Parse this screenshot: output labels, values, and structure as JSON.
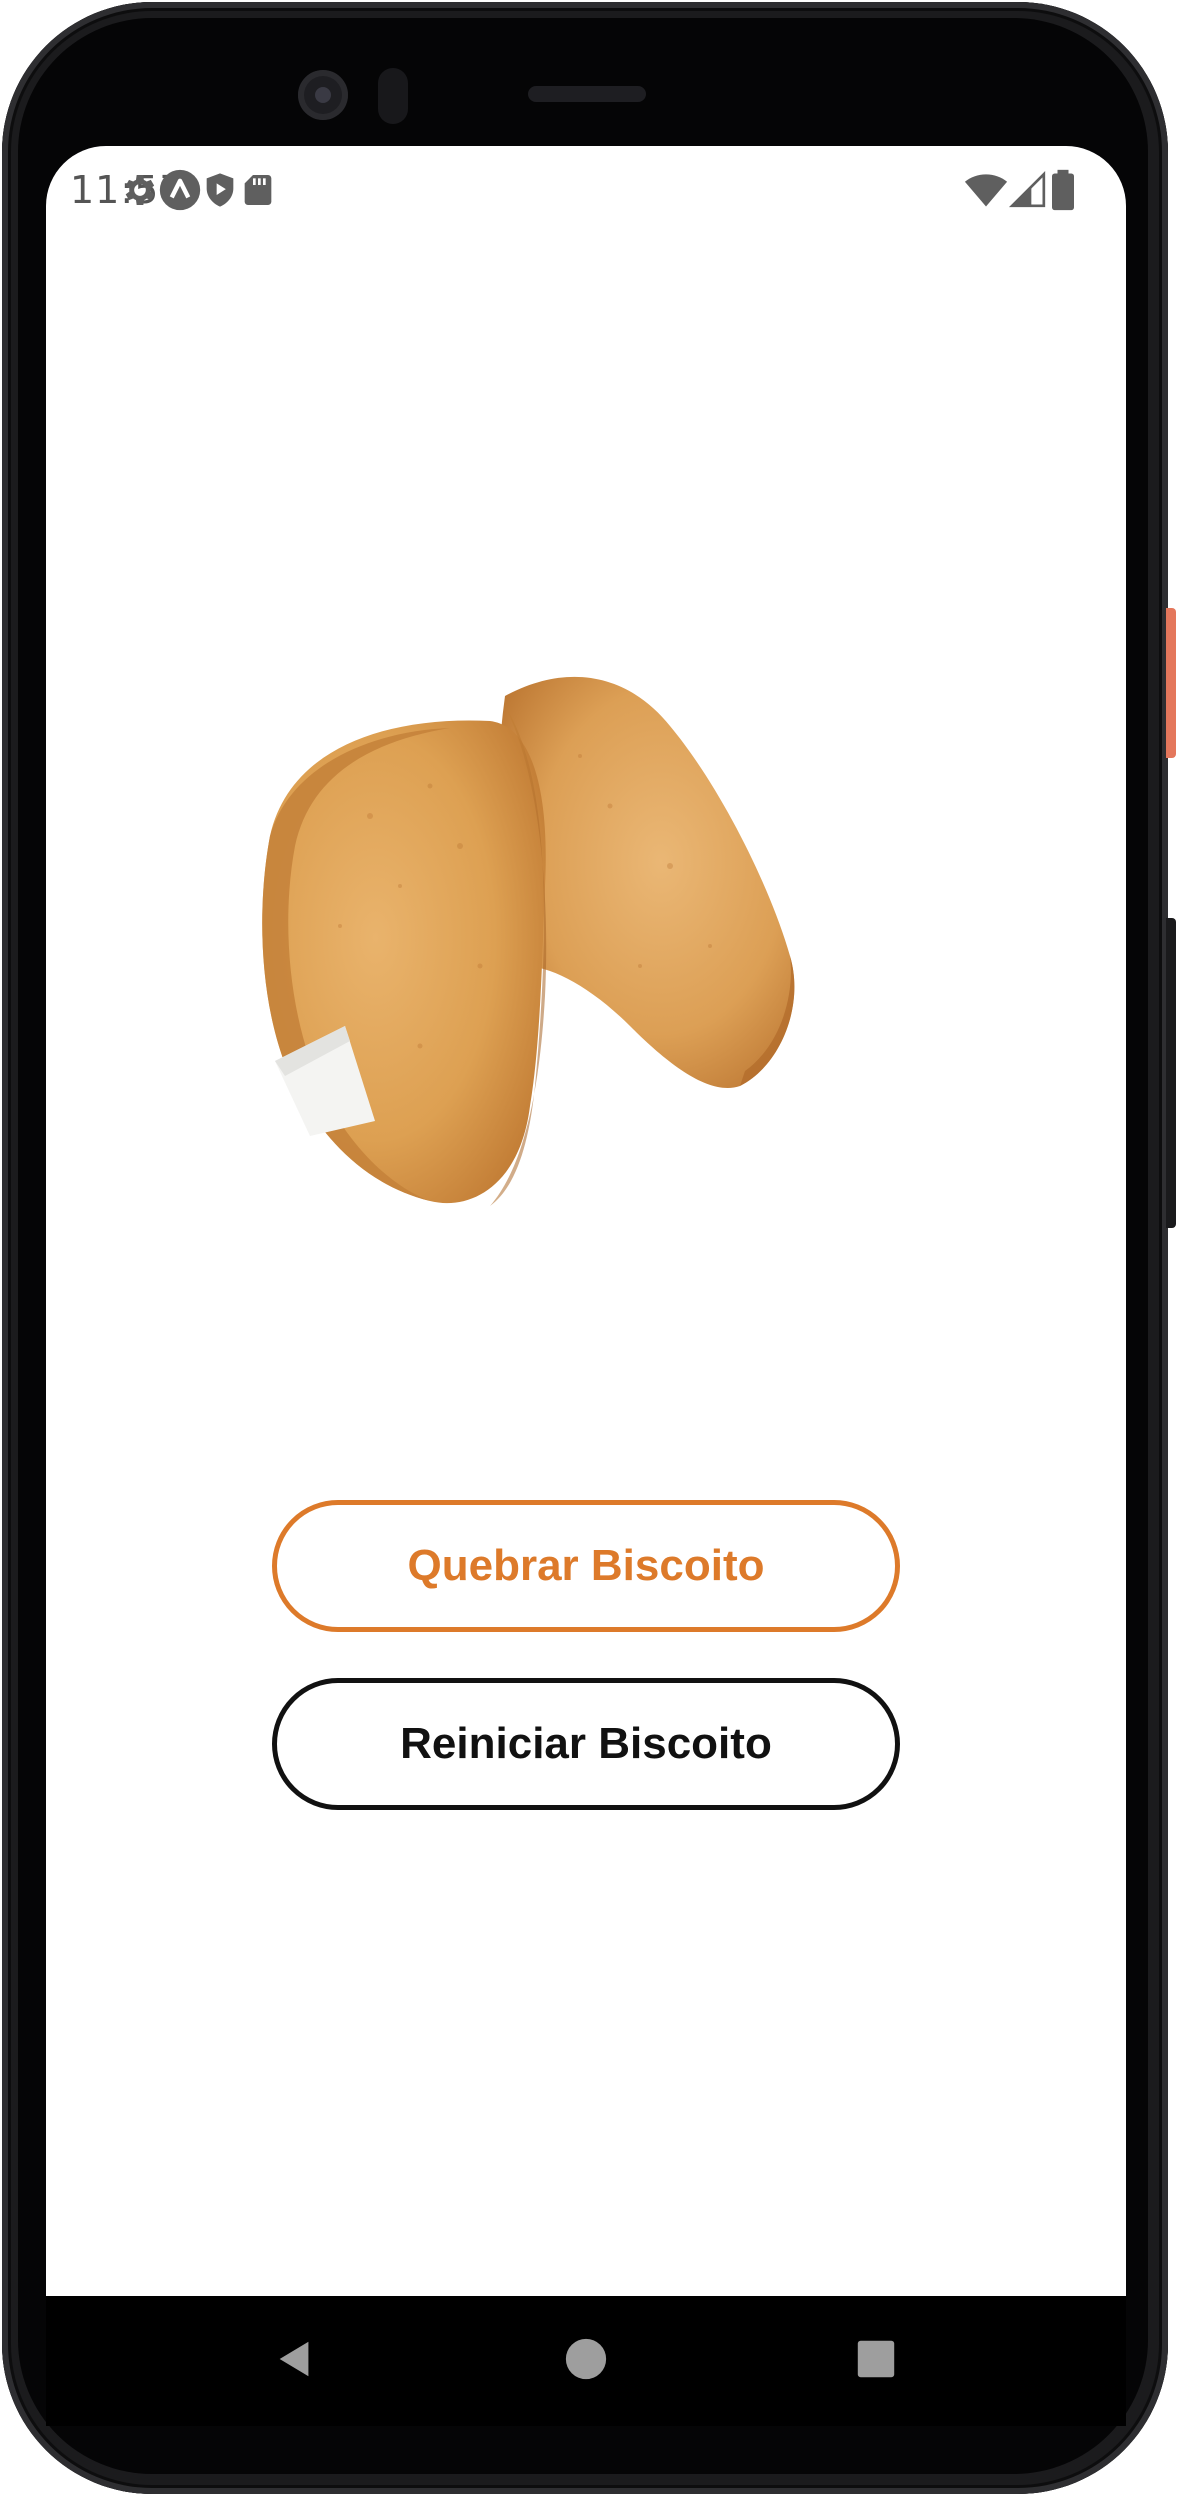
{
  "status_bar": {
    "time": "11:57",
    "left_icons": [
      "settings-icon",
      "app-launcher-icon",
      "play-shield-icon",
      "sd-card-icon"
    ],
    "right_icons": [
      "wifi-icon",
      "cellular-signal-icon",
      "battery-icon"
    ]
  },
  "content": {
    "image": "fortune-cookie",
    "break_button_label": "Quebrar Biscoito",
    "reset_button_label": "Reiniciar Biscoito"
  },
  "nav_bar": {
    "icons": [
      "back-icon",
      "home-icon",
      "recents-icon"
    ]
  },
  "colors": {
    "accent": "#dd7a2a",
    "text_dark": "#111111",
    "background": "#ffffff",
    "device_frame": "#1b1b1d",
    "power_button": "#e4775c"
  }
}
